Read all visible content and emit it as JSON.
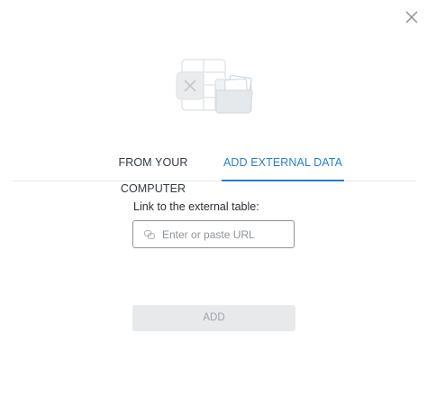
{
  "dialog": {
    "close_icon": "close-icon",
    "illustration_icon": "files-illustration-icon"
  },
  "tabs": [
    {
      "label": "FROM YOUR COMPUTER",
      "active": false
    },
    {
      "label": "ADD EXTERNAL DATA",
      "active": true
    }
  ],
  "external": {
    "label": "Link to the external table:",
    "url_value": "",
    "url_placeholder": "Enter or paste URL",
    "link_icon": "link-icon",
    "add_label": "ADD",
    "add_enabled": false
  },
  "colors": {
    "accent": "#2a7ecf",
    "tab_inactive": "#333a44",
    "button_disabled_bg": "#e8e9eb",
    "button_disabled_text": "#9ea3aa"
  }
}
